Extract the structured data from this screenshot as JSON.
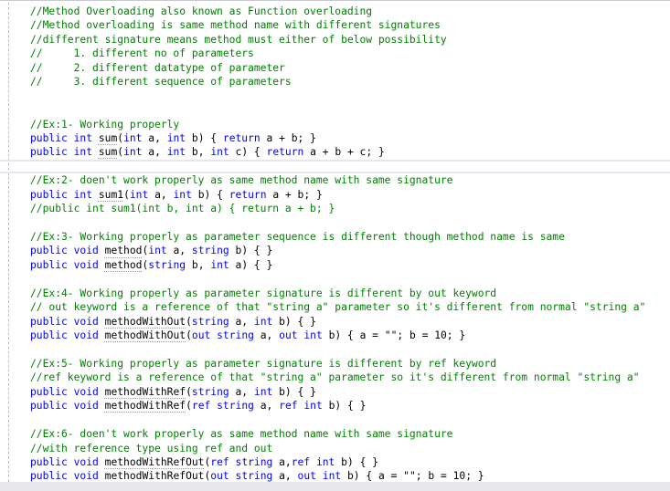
{
  "editor": {
    "colors": {
      "comment": "#008000",
      "keyword": "#0000ff",
      "identifier": "#000000",
      "error_squiggle": "#e51400"
    },
    "lines": [
      {
        "tokens": [
          {
            "t": "cm",
            "v": "//Method Overloading also known as Function overloading"
          }
        ]
      },
      {
        "tokens": [
          {
            "t": "cm",
            "v": "//Method overloading is same method name with different signatures"
          }
        ]
      },
      {
        "tokens": [
          {
            "t": "cm",
            "v": "//different signature means method must either of below possibility"
          }
        ]
      },
      {
        "tokens": [
          {
            "t": "cm",
            "v": "//     1. different no of parameters"
          }
        ]
      },
      {
        "tokens": [
          {
            "t": "cm",
            "v": "//     2. different datatype of parameter"
          }
        ]
      },
      {
        "tokens": [
          {
            "t": "cm",
            "v": "//     3. different sequence of parameters"
          }
        ]
      },
      {
        "tokens": []
      },
      {
        "tokens": []
      },
      {
        "tokens": [
          {
            "t": "cm",
            "v": "//Ex:1- Working properly"
          }
        ]
      },
      {
        "tokens": [
          {
            "t": "kw",
            "v": "public"
          },
          {
            "t": "id",
            "v": " "
          },
          {
            "t": "kw",
            "v": "int"
          },
          {
            "t": "id",
            "v": " "
          },
          {
            "t": "id",
            "v": "sum",
            "hint": true
          },
          {
            "t": "id",
            "v": "("
          },
          {
            "t": "kw",
            "v": "int"
          },
          {
            "t": "id",
            "v": " a, "
          },
          {
            "t": "kw",
            "v": "int"
          },
          {
            "t": "id",
            "v": " b) { "
          },
          {
            "t": "kw",
            "v": "return"
          },
          {
            "t": "id",
            "v": " a + b; }"
          }
        ]
      },
      {
        "tokens": [
          {
            "t": "kw",
            "v": "public"
          },
          {
            "t": "id",
            "v": " "
          },
          {
            "t": "kw",
            "v": "int"
          },
          {
            "t": "id",
            "v": " "
          },
          {
            "t": "id",
            "v": "sum",
            "hint": true
          },
          {
            "t": "id",
            "v": "("
          },
          {
            "t": "kw",
            "v": "int"
          },
          {
            "t": "id",
            "v": " a, "
          },
          {
            "t": "kw",
            "v": "int"
          },
          {
            "t": "id",
            "v": " b, "
          },
          {
            "t": "kw",
            "v": "int"
          },
          {
            "t": "id",
            "v": " c) { "
          },
          {
            "t": "kw",
            "v": "return"
          },
          {
            "t": "id",
            "v": " a + b + c; }"
          }
        ]
      },
      {
        "tokens": [],
        "current": true
      },
      {
        "tokens": [
          {
            "t": "cm",
            "v": "//Ex:2- doen't work properly as same method name with same signature"
          }
        ]
      },
      {
        "tokens": [
          {
            "t": "kw",
            "v": "public"
          },
          {
            "t": "id",
            "v": " "
          },
          {
            "t": "kw",
            "v": "int"
          },
          {
            "t": "id",
            "v": " "
          },
          {
            "t": "id",
            "v": "sum1",
            "hint": true
          },
          {
            "t": "id",
            "v": "("
          },
          {
            "t": "kw",
            "v": "int"
          },
          {
            "t": "id",
            "v": " a, "
          },
          {
            "t": "kw",
            "v": "int"
          },
          {
            "t": "id",
            "v": " b) { "
          },
          {
            "t": "kw",
            "v": "return"
          },
          {
            "t": "id",
            "v": " a + b; }"
          }
        ]
      },
      {
        "tokens": [
          {
            "t": "cm",
            "v": "//public int sum1(int b, int a) { return a + b; }"
          }
        ]
      },
      {
        "tokens": []
      },
      {
        "tokens": [
          {
            "t": "cm",
            "v": "//Ex:3- Working properly as parameter sequence is different though method name is same"
          }
        ]
      },
      {
        "tokens": [
          {
            "t": "kw",
            "v": "public"
          },
          {
            "t": "id",
            "v": " "
          },
          {
            "t": "kw",
            "v": "void"
          },
          {
            "t": "id",
            "v": " "
          },
          {
            "t": "id",
            "v": "method",
            "hint": true
          },
          {
            "t": "id",
            "v": "("
          },
          {
            "t": "kw",
            "v": "int"
          },
          {
            "t": "id",
            "v": " a, "
          },
          {
            "t": "kw",
            "v": "string"
          },
          {
            "t": "id",
            "v": " b) { }"
          }
        ]
      },
      {
        "tokens": [
          {
            "t": "kw",
            "v": "public"
          },
          {
            "t": "id",
            "v": " "
          },
          {
            "t": "kw",
            "v": "void"
          },
          {
            "t": "id",
            "v": " "
          },
          {
            "t": "id",
            "v": "method",
            "hint": true
          },
          {
            "t": "id",
            "v": "("
          },
          {
            "t": "kw",
            "v": "string"
          },
          {
            "t": "id",
            "v": " b, "
          },
          {
            "t": "kw",
            "v": "int"
          },
          {
            "t": "id",
            "v": " a) { }"
          }
        ]
      },
      {
        "tokens": []
      },
      {
        "tokens": [
          {
            "t": "cm",
            "v": "//Ex:4- Working properly as parameter signature is different by out keyword"
          }
        ]
      },
      {
        "tokens": [
          {
            "t": "cm",
            "v": "// out keyword is a reference of that \"string a\" parameter so it's different from normal \"string a\""
          }
        ]
      },
      {
        "tokens": [
          {
            "t": "kw",
            "v": "public"
          },
          {
            "t": "id",
            "v": " "
          },
          {
            "t": "kw",
            "v": "void"
          },
          {
            "t": "id",
            "v": " "
          },
          {
            "t": "id",
            "v": "methodWithOut",
            "hint": true
          },
          {
            "t": "id",
            "v": "("
          },
          {
            "t": "kw",
            "v": "string"
          },
          {
            "t": "id",
            "v": " a, "
          },
          {
            "t": "kw",
            "v": "int"
          },
          {
            "t": "id",
            "v": " b) { }"
          }
        ]
      },
      {
        "tokens": [
          {
            "t": "kw",
            "v": "public"
          },
          {
            "t": "id",
            "v": " "
          },
          {
            "t": "kw",
            "v": "void"
          },
          {
            "t": "id",
            "v": " "
          },
          {
            "t": "id",
            "v": "methodWithOut",
            "hint": true
          },
          {
            "t": "id",
            "v": "("
          },
          {
            "t": "kw",
            "v": "out"
          },
          {
            "t": "id",
            "v": " "
          },
          {
            "t": "kw",
            "v": "string"
          },
          {
            "t": "id",
            "v": " a, "
          },
          {
            "t": "kw",
            "v": "out"
          },
          {
            "t": "id",
            "v": " "
          },
          {
            "t": "kw",
            "v": "int"
          },
          {
            "t": "id",
            "v": " b) { a = \"\"; b = 10; }"
          }
        ]
      },
      {
        "tokens": []
      },
      {
        "tokens": [
          {
            "t": "cm",
            "v": "//Ex:5- Working properly as parameter signature is different by ref keyword"
          }
        ]
      },
      {
        "tokens": [
          {
            "t": "cm",
            "v": "//ref keyword is a reference of that \"string a\" parameter so it's different from normal \"string a\""
          }
        ]
      },
      {
        "tokens": [
          {
            "t": "kw",
            "v": "public"
          },
          {
            "t": "id",
            "v": " "
          },
          {
            "t": "kw",
            "v": "void"
          },
          {
            "t": "id",
            "v": " "
          },
          {
            "t": "id",
            "v": "methodWithRef",
            "hint": true
          },
          {
            "t": "id",
            "v": "("
          },
          {
            "t": "kw",
            "v": "string"
          },
          {
            "t": "id",
            "v": " a, "
          },
          {
            "t": "kw",
            "v": "int"
          },
          {
            "t": "id",
            "v": " b) { }"
          }
        ]
      },
      {
        "tokens": [
          {
            "t": "kw",
            "v": "public"
          },
          {
            "t": "id",
            "v": " "
          },
          {
            "t": "kw",
            "v": "void"
          },
          {
            "t": "id",
            "v": " "
          },
          {
            "t": "id",
            "v": "methodWithRef",
            "hint": true
          },
          {
            "t": "id",
            "v": "("
          },
          {
            "t": "kw",
            "v": "ref"
          },
          {
            "t": "id",
            "v": " "
          },
          {
            "t": "kw",
            "v": "string"
          },
          {
            "t": "id",
            "v": " a, "
          },
          {
            "t": "kw",
            "v": "ref"
          },
          {
            "t": "id",
            "v": " "
          },
          {
            "t": "kw",
            "v": "int"
          },
          {
            "t": "id",
            "v": " b) { }"
          }
        ]
      },
      {
        "tokens": []
      },
      {
        "tokens": [
          {
            "t": "cm",
            "v": "//Ex:6- doen't work properly as same method name with same signature"
          }
        ]
      },
      {
        "tokens": [
          {
            "t": "cm",
            "v": "//with reference type using ref and out"
          }
        ]
      },
      {
        "tokens": [
          {
            "t": "kw",
            "v": "public"
          },
          {
            "t": "id",
            "v": " "
          },
          {
            "t": "kw",
            "v": "void"
          },
          {
            "t": "id",
            "v": " "
          },
          {
            "t": "id",
            "v": "methodWithRefOut",
            "hint": true
          },
          {
            "t": "id",
            "v": "("
          },
          {
            "t": "kw",
            "v": "ref"
          },
          {
            "t": "id",
            "v": " "
          },
          {
            "t": "kw",
            "v": "string"
          },
          {
            "t": "id",
            "v": " a,"
          },
          {
            "t": "kw",
            "v": "ref"
          },
          {
            "t": "id",
            "v": " "
          },
          {
            "t": "kw",
            "v": "int"
          },
          {
            "t": "id",
            "v": " b) { }"
          }
        ]
      },
      {
        "tokens": [
          {
            "t": "kw",
            "v": "public"
          },
          {
            "t": "id",
            "v": " "
          },
          {
            "t": "kw",
            "v": "void"
          },
          {
            "t": "id",
            "v": " "
          },
          {
            "t": "id",
            "v": "methodWithRefOut",
            "error": true
          },
          {
            "t": "id",
            "v": "("
          },
          {
            "t": "kw",
            "v": "out"
          },
          {
            "t": "id",
            "v": " "
          },
          {
            "t": "kw",
            "v": "string"
          },
          {
            "t": "id",
            "v": " a, "
          },
          {
            "t": "kw",
            "v": "out"
          },
          {
            "t": "id",
            "v": " "
          },
          {
            "t": "kw",
            "v": "int"
          },
          {
            "t": "id",
            "v": " b) { a = \"\"; b = 10; }"
          }
        ]
      }
    ]
  }
}
